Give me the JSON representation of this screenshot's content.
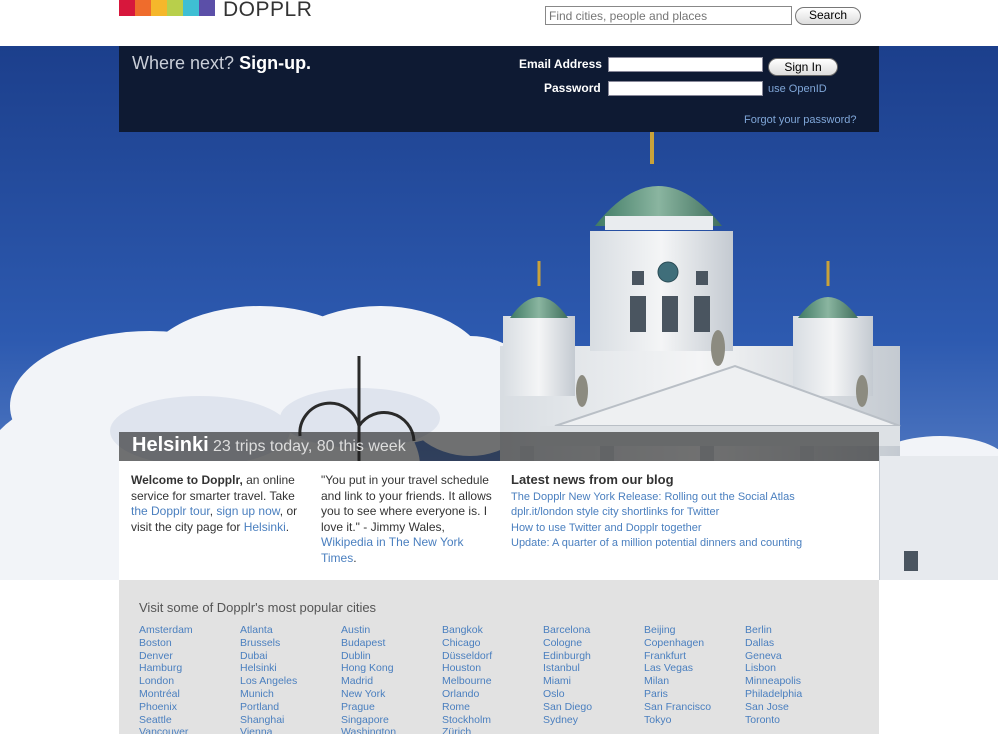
{
  "brand": {
    "name": "DOPPLR",
    "logo_colors": [
      "#d7173c",
      "#ef6c2c",
      "#f5b72b",
      "#b8cf4b",
      "#3fbfd3",
      "#5b4fa8"
    ]
  },
  "search": {
    "placeholder": "Find cities, people and places",
    "button_label": "Search"
  },
  "signup": {
    "prompt": "Where next?",
    "cta": "Sign-up.",
    "email_label": "Email Address",
    "password_label": "Password",
    "signin_label": "Sign In",
    "openid_label": "use OpenID",
    "forgot_label": "Forgot your password?"
  },
  "city_banner": {
    "name": "Helsinki",
    "stats": "23 trips today, 80 this week"
  },
  "intro": {
    "welcome_bold": "Welcome to Dopplr,",
    "welcome_text": " an online service for smarter travel. Take ",
    "tour_link": "the Dopplr tour",
    "comma": ", ",
    "signup_link": "sign up now",
    "visit_text": ", or visit the city page for ",
    "city_link": "Helsinki",
    "period": "."
  },
  "quote": {
    "text": "\"You put in your travel schedule and link to your friends. It allows you to see where everyone is. I love it.\" - Jimmy Wales, ",
    "source_link": "Wikipedia in The New York Times",
    "period": "."
  },
  "news": {
    "title": "Latest news from our blog",
    "items": [
      "The Dopplr New York Release: Rolling out the Social Atlas",
      "dplr.it/london style city shortlinks for Twitter",
      "How to use Twitter and Dopplr together",
      "Update: A quarter of a million potential dinners and counting"
    ]
  },
  "popular": {
    "title": "Visit some of Dopplr's most popular cities",
    "columns": [
      [
        "Amsterdam",
        "Boston",
        "Denver",
        "Hamburg",
        "London",
        "Montréal",
        "Phoenix",
        "Seattle",
        "Vancouver"
      ],
      [
        "Atlanta",
        "Brussels",
        "Dubai",
        "Helsinki",
        "Los Angeles",
        "Munich",
        "Portland",
        "Shanghai",
        "Vienna"
      ],
      [
        "Austin",
        "Budapest",
        "Dublin",
        "Hong Kong",
        "Madrid",
        "New York",
        "Prague",
        "Singapore",
        "Washington"
      ],
      [
        "Bangkok",
        "Chicago",
        "Düsseldorf",
        "Houston",
        "Melbourne",
        "Orlando",
        "Rome",
        "Stockholm",
        "Zürich"
      ],
      [
        "Barcelona",
        "Cologne",
        "Edinburgh",
        "Istanbul",
        "Miami",
        "Oslo",
        "San Diego",
        "Sydney"
      ],
      [
        "Beijing",
        "Copenhagen",
        "Frankfurt",
        "Las Vegas",
        "Milan",
        "Paris",
        "San Francisco",
        "Tokyo"
      ],
      [
        "Berlin",
        "Dallas",
        "Geneva",
        "Lisbon",
        "Minneapolis",
        "Philadelphia",
        "San Jose",
        "Toronto"
      ]
    ]
  }
}
